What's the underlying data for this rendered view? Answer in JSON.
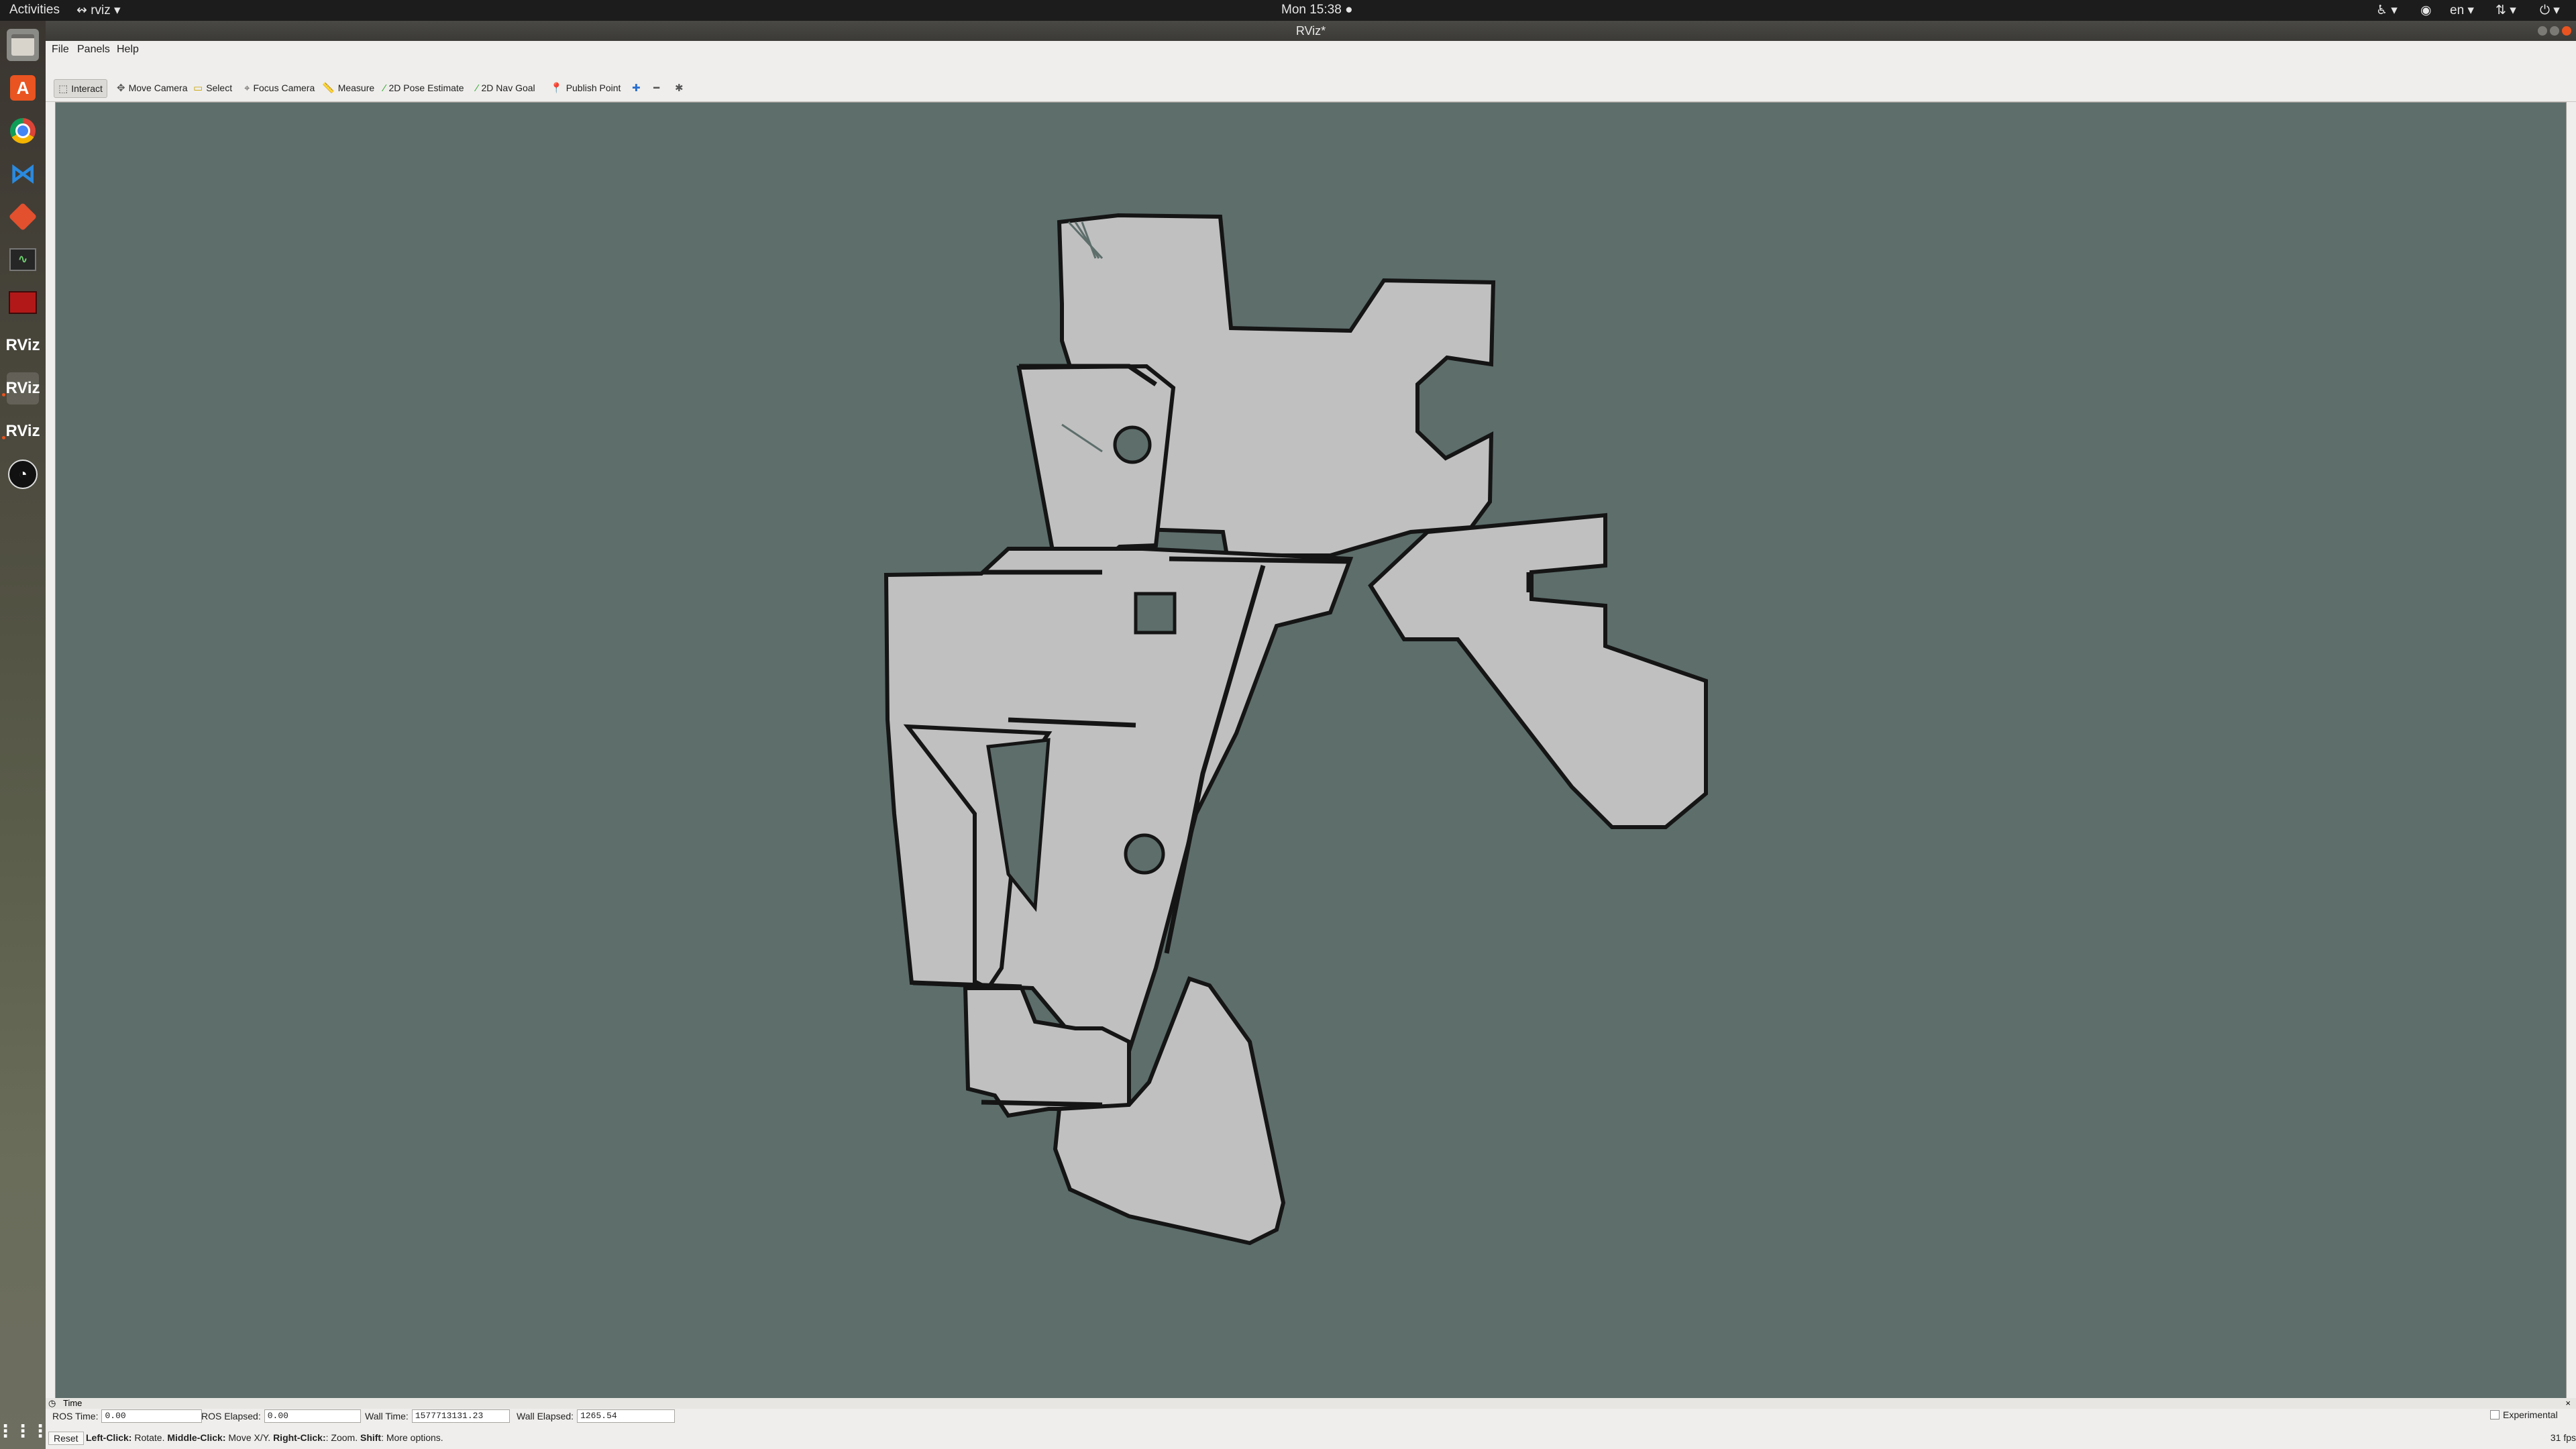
{
  "topbar": {
    "activities": "Activities",
    "app_menu": "rviz",
    "clock": "Mon 15:38",
    "language": "en"
  },
  "dock": {
    "items": [
      {
        "name": "files",
        "active": false
      },
      {
        "name": "software",
        "active": false
      },
      {
        "name": "chrome",
        "active": false
      },
      {
        "name": "vscode",
        "active": false
      },
      {
        "name": "git",
        "active": false
      },
      {
        "name": "system-monitor",
        "active": false
      },
      {
        "name": "terminal-red",
        "active": false
      },
      {
        "name": "rviz",
        "label": "RViz",
        "active": false
      },
      {
        "name": "rviz",
        "label": "RViz",
        "active": true
      },
      {
        "name": "rviz",
        "label": "RViz",
        "active": false
      },
      {
        "name": "obs",
        "active": false
      }
    ]
  },
  "window": {
    "title": "RViz*"
  },
  "menubar": {
    "file": "File",
    "panels": "Panels",
    "help": "Help"
  },
  "toolbar": {
    "interact": "Interact",
    "move_camera": "Move Camera",
    "select": "Select",
    "focus_camera": "Focus Camera",
    "measure": "Measure",
    "pose_estimate": "2D Pose Estimate",
    "nav_goal": "2D Nav Goal",
    "publish_point": "Publish Point"
  },
  "map": {
    "colors": {
      "background": "#5d6e6b",
      "free": "#c0c0c0",
      "wall": "#151515"
    }
  },
  "time_panel": {
    "title": "Time",
    "ros_time_label": "ROS Time:",
    "ros_time_value": "0.00",
    "ros_elapsed_label": "ROS Elapsed:",
    "ros_elapsed_value": "0.00",
    "wall_time_label": "Wall Time:",
    "wall_time_value": "1577713131.23",
    "wall_elapsed_label": "Wall Elapsed:",
    "wall_elapsed_value": "1265.54",
    "experimental": "Experimental"
  },
  "status": {
    "reset": "Reset",
    "left_click": "Left-Click:",
    "left_click_desc": " Rotate. ",
    "middle_click": "Middle-Click:",
    "middle_click_desc": " Move X/Y. ",
    "right_click": "Right-Click:",
    "right_click_desc": ": Zoom. ",
    "shift": "Shift",
    "shift_desc": ": More options.",
    "fps": "31 fps"
  }
}
